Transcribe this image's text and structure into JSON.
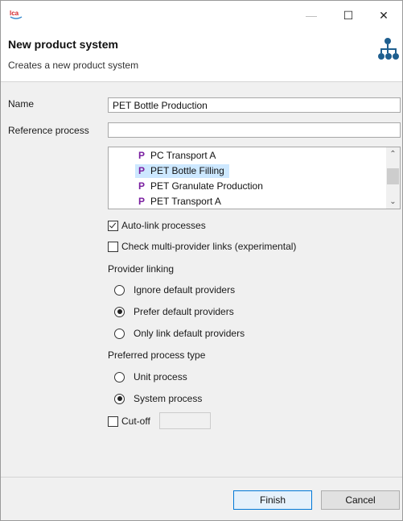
{
  "window": {
    "app_icon_label": "LCA",
    "controls": {
      "minimize": "—",
      "maximize": "☐",
      "close": "✕"
    }
  },
  "header": {
    "title": "New product system",
    "description": "Creates a new product system",
    "icon": "hierarchy-icon"
  },
  "form": {
    "name_label": "Name",
    "name_value": "PET Bottle Production",
    "reference_label": "Reference process",
    "reference_value": "",
    "process_list": [
      {
        "prefix": "P",
        "label": "PC Transport A",
        "selected": false
      },
      {
        "prefix": "P",
        "label": "PET Bottle Filling",
        "selected": true
      },
      {
        "prefix": "P",
        "label": "PET Granulate Production",
        "selected": false
      },
      {
        "prefix": "P",
        "label": "PET Transport A",
        "selected": false
      }
    ],
    "auto_link": {
      "label": "Auto-link processes",
      "checked": true
    },
    "multi_provider": {
      "label": "Check multi-provider links (experimental)",
      "checked": false
    },
    "provider_linking": {
      "label": "Provider linking",
      "options": [
        {
          "label": "Ignore default providers",
          "selected": false
        },
        {
          "label": "Prefer default providers",
          "selected": true
        },
        {
          "label": "Only link default providers",
          "selected": false
        }
      ]
    },
    "process_type": {
      "label": "Preferred process type",
      "options": [
        {
          "label": "Unit process",
          "selected": false
        },
        {
          "label": "System process",
          "selected": true
        }
      ]
    },
    "cutoff": {
      "label": "Cut-off",
      "checked": false,
      "value": ""
    }
  },
  "buttons": {
    "finish": "Finish",
    "cancel": "Cancel"
  },
  "colors": {
    "accent": "#0078d7",
    "selection": "#cde8ff",
    "process_letter": "#7a1fa0"
  }
}
